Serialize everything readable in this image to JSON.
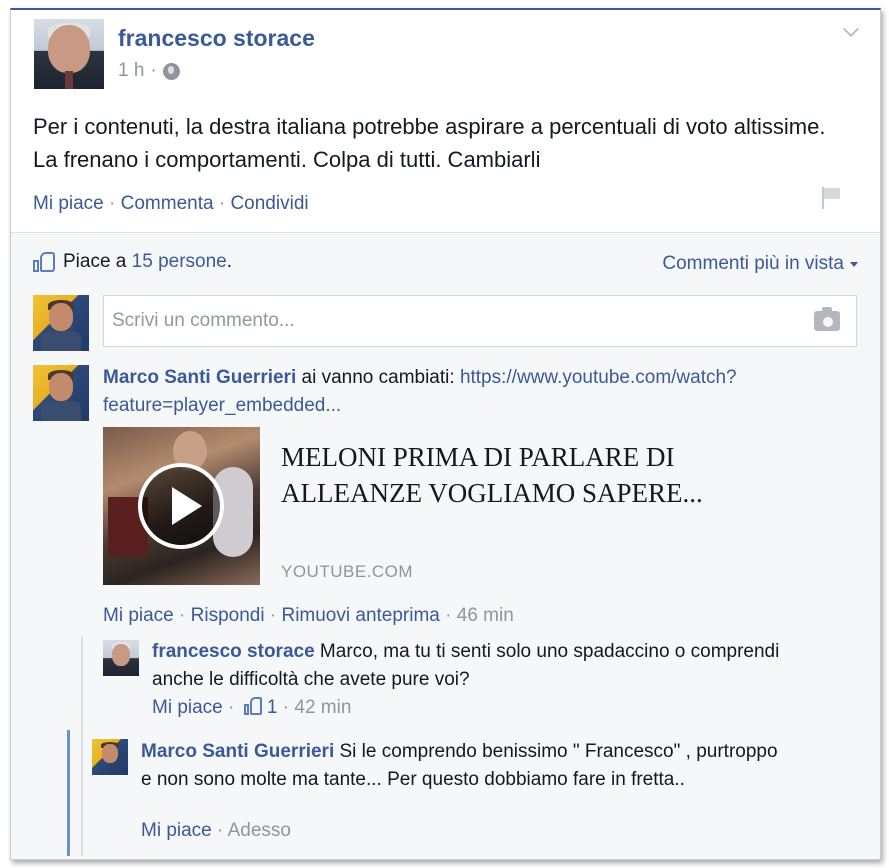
{
  "post": {
    "author": "francesco storace",
    "time": "1 h",
    "separator": "·",
    "text": "Per i contenuti, la destra italiana potrebbe aspirare a percentuali di voto altissime. La frenano i comportamenti. Colpa di tutti. Cambiarli",
    "actions": {
      "like": "Mi piace",
      "comment": "Commenta",
      "share": "Condividi",
      "sep": " · "
    }
  },
  "feedback": {
    "likes_prefix": "Piace a",
    "likes_link": "15 persone",
    "likes_suffix": ".",
    "sort_label": "Commenti più in vista",
    "comment_placeholder": "Scrivi un commento..."
  },
  "comments": [
    {
      "author": "Marco Santi Guerrieri",
      "text": " ai vanno cambiati: ",
      "link": "https://www.youtube.com/watch?feature=player_embedded...",
      "preview": {
        "title": "MELONI PRIMA DI PARLARE DI ALLEANZE VOGLIAMO SAPERE...",
        "source": "YOUTUBE.COM"
      },
      "actions": {
        "like": "Mi piace",
        "reply": "Rispondi",
        "remove_preview": "Rimuovi anteprima",
        "time": "46 min"
      }
    }
  ],
  "replies": [
    {
      "author": "francesco storace",
      "text": " Marco, ma tu ti senti solo uno spadaccino o comprendi anche le difficoltà che avete pure voi?",
      "actions": {
        "like": "Mi piace",
        "like_count": "1",
        "time": "42 min"
      }
    },
    {
      "author": "Marco Santi Guerrieri",
      "text": " Si le comprendo benissimo \" Francesco\" , purtroppo e non sono molte ma tante... Per questo dobbiamo fare in fretta..",
      "actions": {
        "like": "Mi piace",
        "time": "Adesso"
      }
    }
  ],
  "icons": {
    "privacy": "globe-icon",
    "menu": "chevron-down-icon",
    "report": "flag-icon",
    "likes": "thumbs-up-icon",
    "photo": "camera-icon",
    "video": "play-icon"
  },
  "colors": {
    "link": "#3b5998",
    "meta": "#90949c",
    "feedback_bg": "#f6f7f9"
  }
}
